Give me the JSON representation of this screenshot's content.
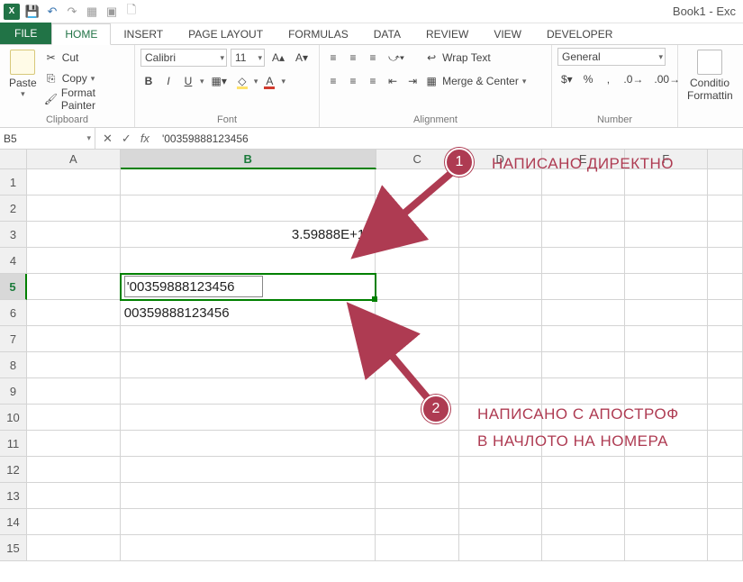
{
  "window": {
    "title": "Book1 - Exc"
  },
  "tabs": {
    "file": "FILE",
    "list": [
      "HOME",
      "INSERT",
      "PAGE LAYOUT",
      "FORMULAS",
      "DATA",
      "REVIEW",
      "VIEW",
      "DEVELOPER"
    ],
    "active_index": 0
  },
  "ribbon": {
    "clipboard": {
      "paste": "Paste",
      "cut": "Cut",
      "copy": "Copy",
      "format_painter": "Format Painter",
      "group_label": "Clipboard"
    },
    "font": {
      "name": "Calibri",
      "size": "11",
      "group_label": "Font",
      "bold": "B",
      "italic": "I",
      "underline": "U"
    },
    "alignment": {
      "wrap": "Wrap Text",
      "merge": "Merge & Center",
      "group_label": "Alignment"
    },
    "number": {
      "format": "General",
      "group_label": "Number"
    },
    "styles": {
      "cond": "Conditio",
      "cond2": "Formattin"
    }
  },
  "formula_bar": {
    "name_box": "B5",
    "formula": "'00359888123456"
  },
  "columns": [
    "A",
    "B",
    "C",
    "D",
    "E",
    "F"
  ],
  "rows": [
    "1",
    "2",
    "3",
    "4",
    "5",
    "6",
    "7",
    "8",
    "9",
    "10",
    "11",
    "12",
    "13",
    "14",
    "15"
  ],
  "selected_row": "5",
  "cells": {
    "B3": "3.59888E+11",
    "B5_edit": "'00359888123456",
    "B6": "00359888123456"
  },
  "annotations": {
    "n1": "1",
    "t1": "НАПИСАНО ДИРЕКТНО",
    "n2": "2",
    "t2a": "НАПИСАНО С АПОСТРОФ",
    "t2b": "В НАЧЛОТО НА НОМЕРА"
  }
}
